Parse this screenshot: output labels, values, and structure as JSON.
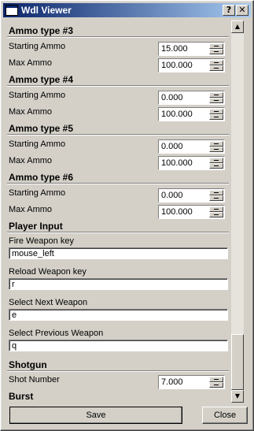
{
  "window": {
    "title": "Wdl Viewer",
    "help_glyph": "?",
    "close_glyph": "✕"
  },
  "sections": {
    "ammo3": {
      "title": "Ammo type #3",
      "starting_label": "Starting Ammo",
      "starting_value": "15.000",
      "max_label": "Max Ammo",
      "max_value": "100.000"
    },
    "ammo4": {
      "title": "Ammo type #4",
      "starting_label": "Starting Ammo",
      "starting_value": "0.000",
      "max_label": "Max Ammo",
      "max_value": "100.000"
    },
    "ammo5": {
      "title": "Ammo type #5",
      "starting_label": "Starting Ammo",
      "starting_value": "0.000",
      "max_label": "Max Ammo",
      "max_value": "100.000"
    },
    "ammo6": {
      "title": "Ammo type #6",
      "starting_label": "Starting Ammo",
      "starting_value": "0.000",
      "max_label": "Max Ammo",
      "max_value": "100.000"
    },
    "player_input": {
      "title": "Player Input",
      "fire_label": "Fire Weapon key",
      "fire_value": "mouse_left",
      "reload_label": "Reload Weapon key",
      "reload_value": "r",
      "next_label": "Select Next Weapon",
      "next_value": "e",
      "prev_label": "Select Previous Weapon",
      "prev_value": "q"
    },
    "shotgun": {
      "title": "Shotgun",
      "shot_label": "Shot Number",
      "shot_value": "7.000"
    },
    "burst": {
      "title": "Burst"
    }
  },
  "scrollbar": {
    "up_glyph": "▲",
    "down_glyph": "▼"
  },
  "buttons": {
    "save": "Save",
    "close": "Close"
  }
}
